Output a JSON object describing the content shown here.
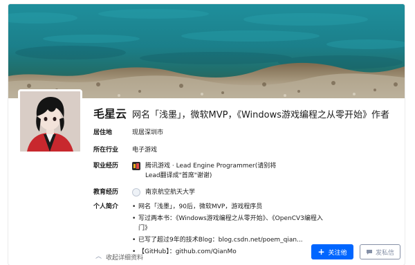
{
  "profile": {
    "name": "毛星云",
    "headline": "网名「浅墨」，微软MVP，《Windows游戏编程之从零开始》作者"
  },
  "details": {
    "location": {
      "label": "居住地",
      "value": "现居深圳市"
    },
    "industry": {
      "label": "所在行业",
      "value": "电子游戏"
    },
    "experience": {
      "label": "职业经历",
      "value": "腾讯游戏 · Lead Engine Programmer(请别将Lead翻译成\"首席\"谢谢)"
    },
    "education": {
      "label": "教育经历",
      "value": "南京航空航天大学"
    },
    "intro": {
      "label": "个人简介",
      "items": [
        "网名「浅墨」，90后，微软MVP，游戏程序员",
        "写过两本书：《Windows游戏编程之从零开始》、《OpenCV3编程入门》",
        "已写了超过9年的技术Blog：blog.csdn.net/poem_qian...",
        "【GitHub】：github.com/QianMo"
      ]
    }
  },
  "actions": {
    "collapse": "收起详细资料",
    "follow": "关注他",
    "message": "发私信"
  },
  "colors": {
    "primary": "#0066ff",
    "secondary_text": "#8590a6",
    "banner_sea": "#1e8a96"
  }
}
